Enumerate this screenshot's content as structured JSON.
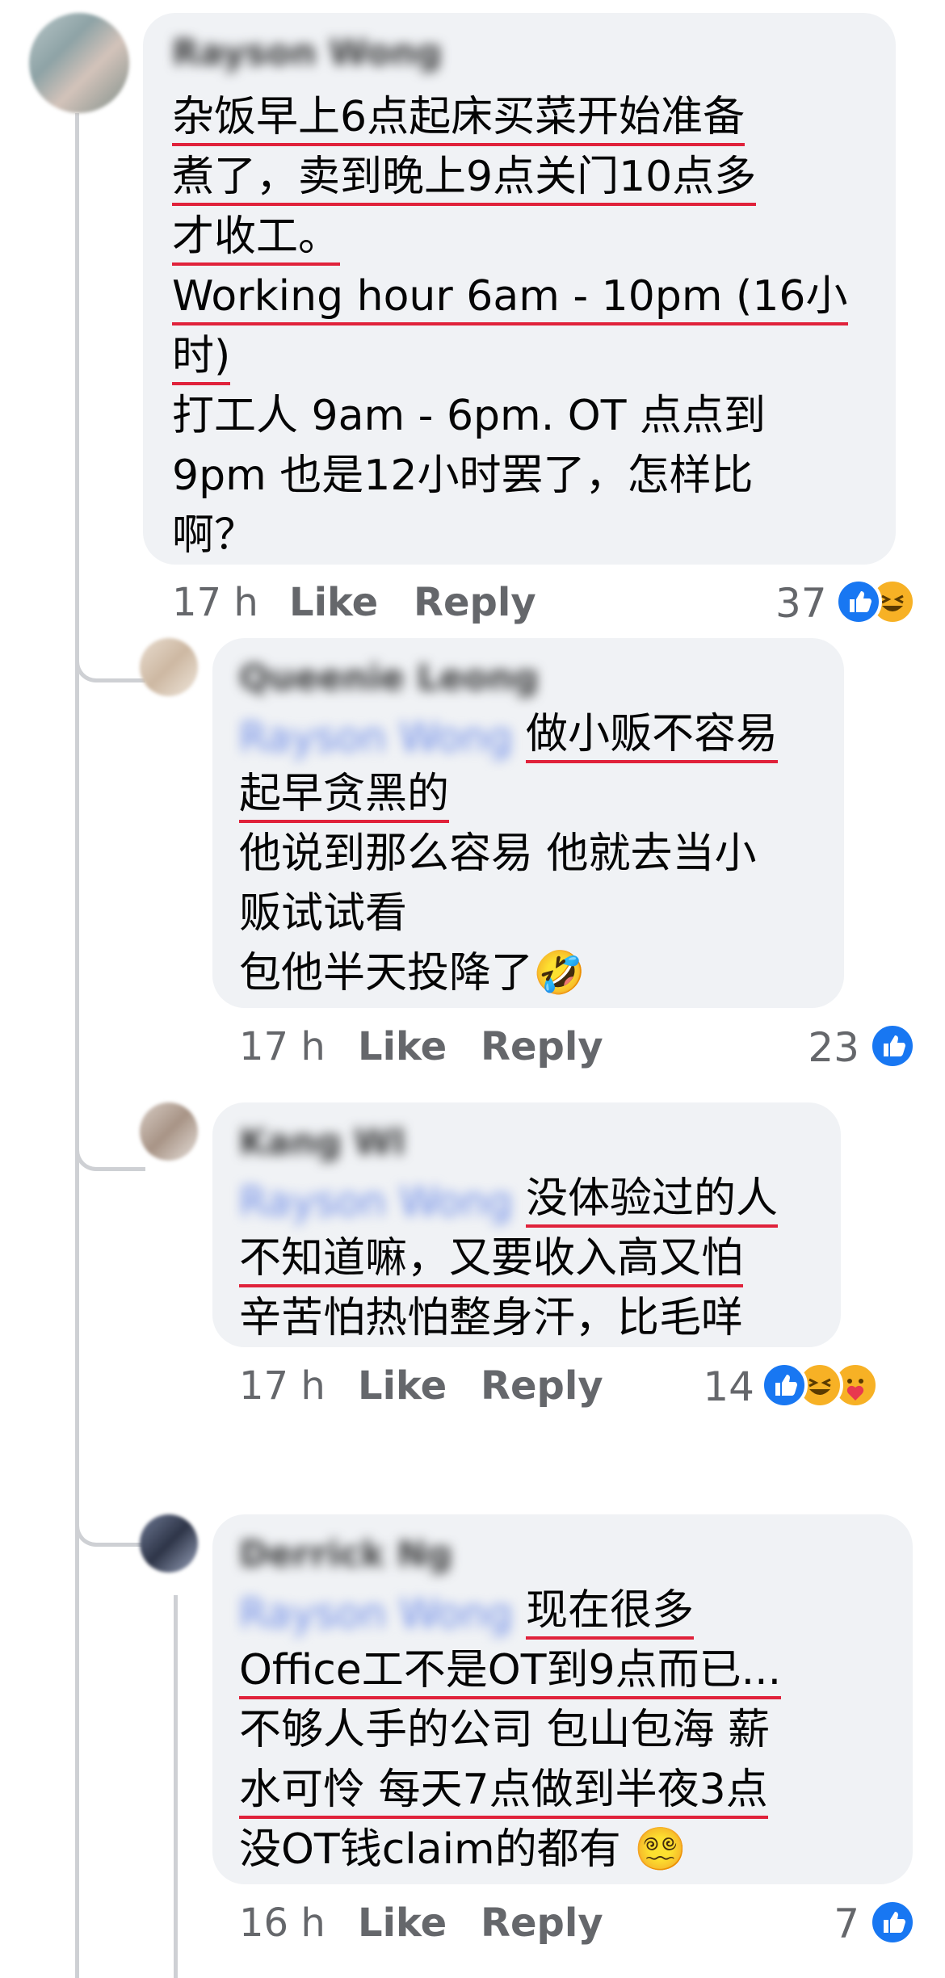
{
  "comments": [
    {
      "author": "Rayson Wong",
      "lines": [
        "杂饭早上6点起床买菜开始准备",
        "煮了，卖到晚上9点关门10点多",
        "才收工。",
        "Working hour 6am - 10pm (16小",
        "时)",
        "打工人 9am - 6pm. OT 点点到",
        "9pm 也是12小时罢了，怎样比",
        "啊？"
      ],
      "time": "17 h",
      "like_label": "Like",
      "reply_label": "Reply",
      "reaction_count": "37",
      "reactions": [
        "like-icon",
        "haha-icon"
      ]
    },
    {
      "author": "Queenie Leong",
      "mention": "Rayson Wong",
      "lines": [
        "做小贩不容易",
        "起早贪黑的",
        "他说到那么容易 他就去当小",
        "贩试试看",
        "包他半天投降了🤣"
      ],
      "time": "17 h",
      "like_label": "Like",
      "reply_label": "Reply",
      "reaction_count": "23",
      "reactions": [
        "like-icon"
      ]
    },
    {
      "author": "Kang Wl",
      "mention": "Rayson Wong",
      "lines": [
        "没体验过的人",
        "不知道嘛，又要收入高又怕",
        "辛苦怕热怕整身汗，比毛咩"
      ],
      "time": "17 h",
      "like_label": "Like",
      "reply_label": "Reply",
      "reaction_count": "14",
      "reactions": [
        "like-icon",
        "haha-icon",
        "care-icon"
      ]
    },
    {
      "author": "Derrick Ng",
      "mention": "Rayson Wong",
      "lines": [
        "现在很多",
        "Office工不是OT到9点而已...",
        "不够人手的公司 包山包海 薪",
        "水可怜 每天7点做到半夜3点",
        "没OT钱claim的都有 😵‍💫"
      ],
      "time": "16 h",
      "like_label": "Like",
      "reply_label": "Reply",
      "reaction_count": "7",
      "reactions": [
        "like-icon"
      ]
    }
  ],
  "colors": {
    "bubble": "#f0f2f5",
    "underline": "#e0223b",
    "like": "#1877f2",
    "mention": "#6b8ae6"
  }
}
